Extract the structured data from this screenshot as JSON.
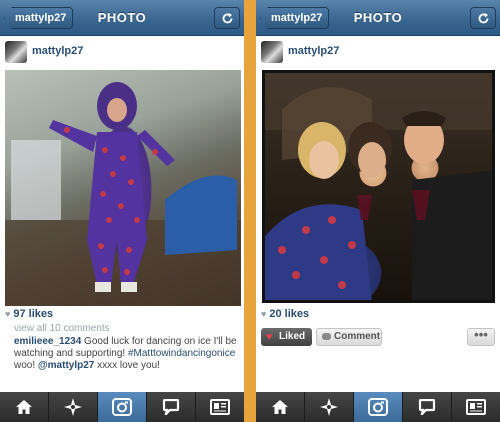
{
  "screens": [
    {
      "nav": {
        "back_label": "mattylp27",
        "title": "PHOTO"
      },
      "post": {
        "username": "mattylp27",
        "likes": "97 likes"
      },
      "comments": {
        "view_all": "view all 10 comments",
        "caption_author": "emilieee_1234",
        "caption_text_1": " Good luck for dancing on ice I'll be watching and supporting! ",
        "caption_hashtag": "#Matttowindancingonice",
        "caption_text_2": " woo! ",
        "caption_mention": "@mattylp27",
        "caption_text_3": " xxxx love you!"
      }
    },
    {
      "nav": {
        "back_label": "mattylp27",
        "title": "PHOTO"
      },
      "post": {
        "username": "mattylp27",
        "likes": "20 likes"
      },
      "actions": {
        "liked_label": "Liked",
        "comment_label": "Comment",
        "more_label": "•••"
      }
    }
  ],
  "tabbar": {
    "items": [
      {
        "icon": "home-icon"
      },
      {
        "icon": "explore-icon"
      },
      {
        "icon": "camera-icon",
        "active": true
      },
      {
        "icon": "news-icon"
      },
      {
        "icon": "profile-icon"
      }
    ]
  },
  "colors": {
    "navbar": "#3a6690",
    "active_tab": "#4a7cad",
    "link": "#2a4d72",
    "liked_heart": "#e8404c",
    "divider": "#e8a43c"
  }
}
